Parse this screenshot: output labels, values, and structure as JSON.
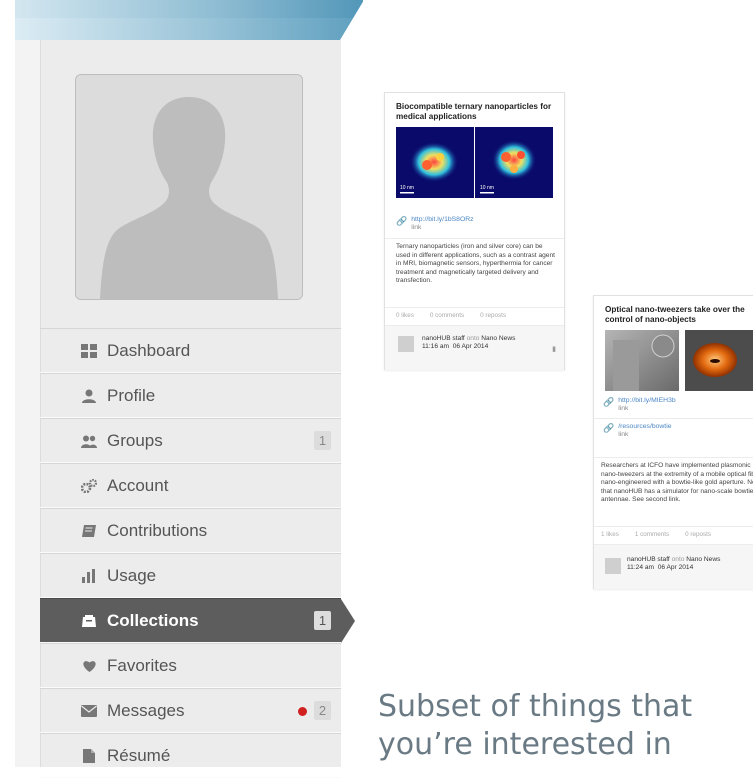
{
  "menu": [
    {
      "label": "Dashboard",
      "icon": "grid-icon"
    },
    {
      "label": "Profile",
      "icon": "person-icon"
    },
    {
      "label": "Groups",
      "icon": "people-icon",
      "count": "1"
    },
    {
      "label": "Account",
      "icon": "gears-icon"
    },
    {
      "label": "Contributions",
      "icon": "notebook-icon"
    },
    {
      "label": "Usage",
      "icon": "bar-chart-icon"
    },
    {
      "label": "Collections",
      "icon": "collection-icon",
      "count": "1",
      "active": true
    },
    {
      "label": "Favorites",
      "icon": "heart-icon"
    },
    {
      "label": "Messages",
      "icon": "envelope-icon",
      "count": "2",
      "alert": true
    },
    {
      "label": "Résumé",
      "icon": "document-icon"
    }
  ],
  "colors": {
    "active_bg": "#5d5d5d",
    "alert": "#d02020",
    "link": "#4a86c5"
  },
  "card1": {
    "title": "Biocompatible ternary nanoparticles for medical applications",
    "scale_label": "10 nm",
    "link_url": "http://bit.ly/1bS8ORz",
    "link_label": "link",
    "description": "Ternary nanoparticles (iron and silver core) can be used in different applications, such as a contrast agent in MRI, biomagnetic sensors, hyperthermia for cancer treatment and magnetically targeted delivery and transfection.",
    "likes": "0 likes",
    "comments": "0 comments",
    "reposts": "0 reposts",
    "author": "nanoHUB staff",
    "onto": "onto",
    "collection": "Nano News",
    "time": "11:16 am",
    "date": "06 Apr 2014"
  },
  "card2": {
    "title": "Optical nano-tweezers take over the control of nano-objects",
    "link1_url": "http://bit.ly/MIEH3b",
    "link1_label": "link",
    "link2_url": "/resources/bowtie",
    "link2_label": "link",
    "description": "Researchers at ICFO have implemented plasmonic nano-tweezers at the extremity of a mobile optical fiber, nano-engineered with a bowtie-like gold aperture. Note that nanoHUB has a simulator for nano-scale bowtie antennae. See second link.",
    "likes": "1 likes",
    "comments": "1 comments",
    "reposts": "0 reposts",
    "author": "nanoHUB staff",
    "onto": "onto",
    "collection": "Nano News",
    "time": "11:24 am",
    "date": "06 Apr 2014"
  },
  "caption": {
    "line1": "Subset of things that",
    "line2": "you’re interested in"
  }
}
